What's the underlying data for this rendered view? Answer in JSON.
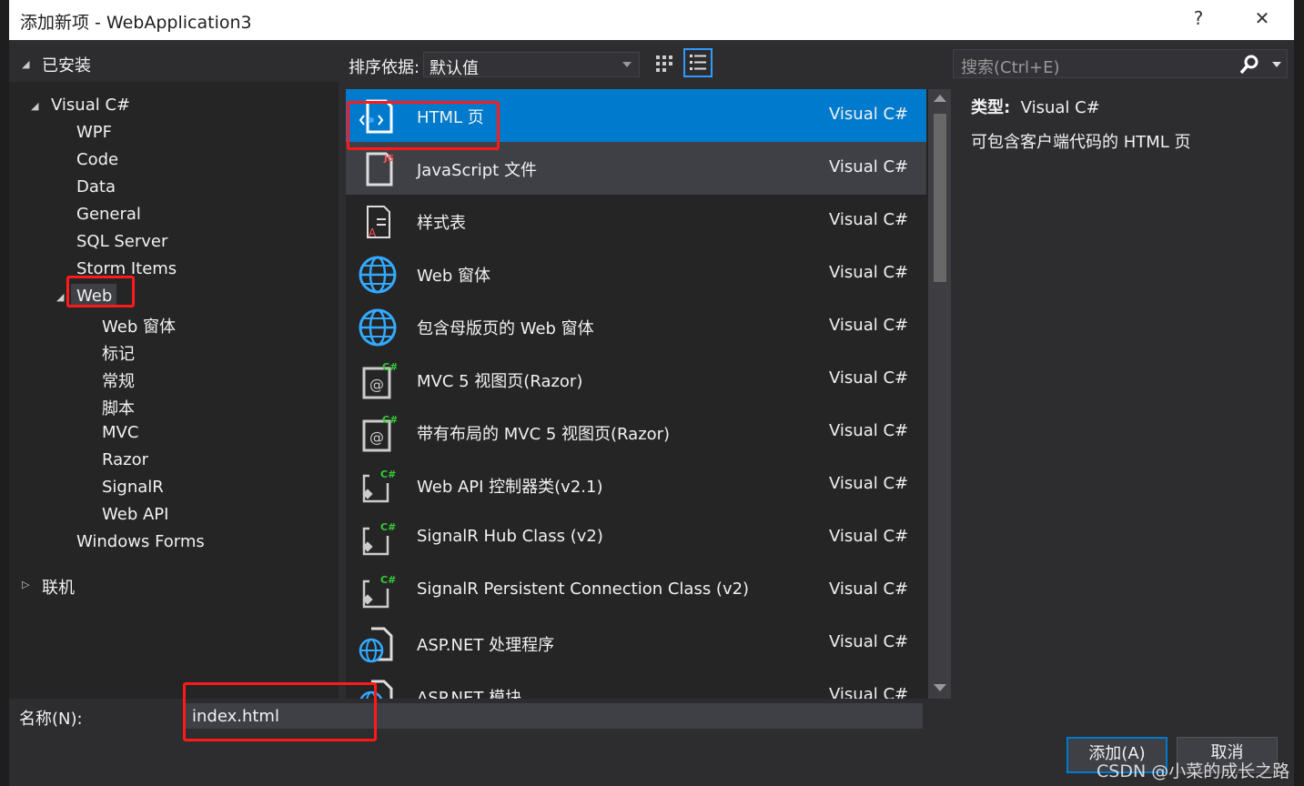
{
  "window": {
    "title": "添加新项 - WebApplication3",
    "help": "?",
    "close": "✕"
  },
  "tree": {
    "installed": "已安装",
    "visual_csharp": "Visual C#",
    "items": [
      "WPF",
      "Code",
      "Data",
      "General",
      "SQL Server",
      "Storm Items"
    ],
    "web": "Web",
    "web_children": [
      "Web 窗体",
      "标记",
      "常规",
      "脚本",
      "MVC",
      "Razor",
      "SignalR",
      "Web API"
    ],
    "windows_forms": "Windows Forms",
    "online": "联机"
  },
  "toolbar": {
    "sort_label": "排序依据:",
    "sort_value": "默认值",
    "search_placeholder": "搜索(Ctrl+E)"
  },
  "templates": [
    {
      "name": "HTML 页",
      "lang": "Visual C#",
      "icon": "html-page-icon",
      "selected": true
    },
    {
      "name": "JavaScript 文件",
      "lang": "Visual C#",
      "icon": "javascript-file-icon"
    },
    {
      "name": "样式表",
      "lang": "Visual C#",
      "icon": "stylesheet-icon"
    },
    {
      "name": "Web 窗体",
      "lang": "Visual C#",
      "icon": "globe-icon"
    },
    {
      "name": "包含母版页的 Web 窗体",
      "lang": "Visual C#",
      "icon": "globe-icon"
    },
    {
      "name": "MVC 5 视图页(Razor)",
      "lang": "Visual C#",
      "icon": "razor-view-icon"
    },
    {
      "name": "带有布局的 MVC 5 视图页(Razor)",
      "lang": "Visual C#",
      "icon": "razor-view-icon"
    },
    {
      "name": "Web API 控制器类(v2.1)",
      "lang": "Visual C#",
      "icon": "csharp-class-icon"
    },
    {
      "name": "SignalR Hub Class (v2)",
      "lang": "Visual C#",
      "icon": "csharp-class-icon"
    },
    {
      "name": "SignalR Persistent Connection Class (v2)",
      "lang": "Visual C#",
      "icon": "csharp-class-icon"
    },
    {
      "name": "ASP.NET 处理程序",
      "lang": "Visual C#",
      "icon": "aspnet-globe-icon"
    },
    {
      "name": "ASP.NET 模块",
      "lang": "Visual C#",
      "icon": "aspnet-globe-icon"
    }
  ],
  "info": {
    "type_label": "类型:",
    "type_value": "Visual C#",
    "description": "可包含客户端代码的 HTML 页"
  },
  "footer": {
    "name_label": "名称(N):",
    "name_value": "index.html",
    "add": "添加(A)",
    "cancel": "取消"
  },
  "watermark": "CSDN @小菜的成长之路",
  "colors": {
    "accent": "#007acc",
    "highlight": "#ff1a1a"
  }
}
